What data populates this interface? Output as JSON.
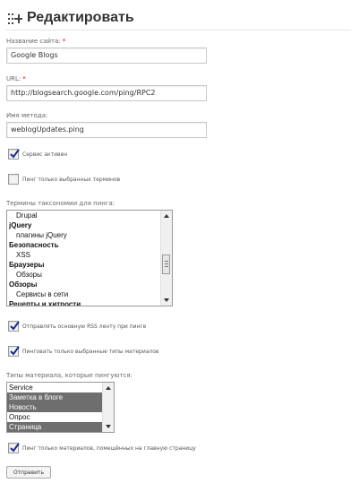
{
  "page_title": "Редактировать",
  "fields": {
    "site_name": {
      "label": "Название сайта:",
      "required_mark": "*",
      "value": "Google Blogs"
    },
    "url": {
      "label": "URL:",
      "required_mark": "*",
      "value": "http://blogsearch.google.com/ping/RPC2"
    },
    "method": {
      "label": "Имя метода:",
      "value": "weblogUpdates.ping"
    }
  },
  "checkboxes": {
    "service_active": {
      "label": "Сервис активен",
      "checked": true
    },
    "ping_selected_terms": {
      "label": "Пинг только выбранных терминов",
      "checked": false
    },
    "send_main_rss": {
      "label": "Отправлять основную RSS ленту при пинге",
      "checked": true
    },
    "ping_selected_types": {
      "label": "Пинговать только выбранные типы материалов",
      "checked": true
    },
    "ping_frontpage_only": {
      "label": "Пинг только материалов, помещённых на главную страницу",
      "checked": true
    }
  },
  "taxonomy": {
    "label": "Термины таксономии для пинга:",
    "options": [
      {
        "text": "Drupal",
        "bold": false,
        "indent": true
      },
      {
        "text": "jQuery",
        "bold": true,
        "indent": false
      },
      {
        "text": "плагины jQuery",
        "bold": false,
        "indent": true
      },
      {
        "text": "Безопасность",
        "bold": true,
        "indent": false
      },
      {
        "text": "XSS",
        "bold": false,
        "indent": true
      },
      {
        "text": "Браузеры",
        "bold": true,
        "indent": false
      },
      {
        "text": "Обзоры",
        "bold": false,
        "indent": true
      },
      {
        "text": "Обзоры",
        "bold": true,
        "indent": false
      },
      {
        "text": "Сервисы в сети",
        "bold": false,
        "indent": true
      },
      {
        "text": "Рецепты и хитрости",
        "bold": true,
        "indent": false
      }
    ],
    "scroll_position": 0.45
  },
  "content_types": {
    "label": "Типы материала, которые пингуются:",
    "options": [
      {
        "text": "Service",
        "selected": false
      },
      {
        "text": "Заметка в блоге",
        "selected": true
      },
      {
        "text": "Новость",
        "selected": true
      },
      {
        "text": "Опрос",
        "selected": false
      },
      {
        "text": "Страница",
        "selected": true
      }
    ]
  },
  "submit_label": "Отправить",
  "colors": {
    "selected_option_bg": "#6e6e6e",
    "required_mark": "#cc0000",
    "checkbox_check": "#1a2a8a"
  }
}
